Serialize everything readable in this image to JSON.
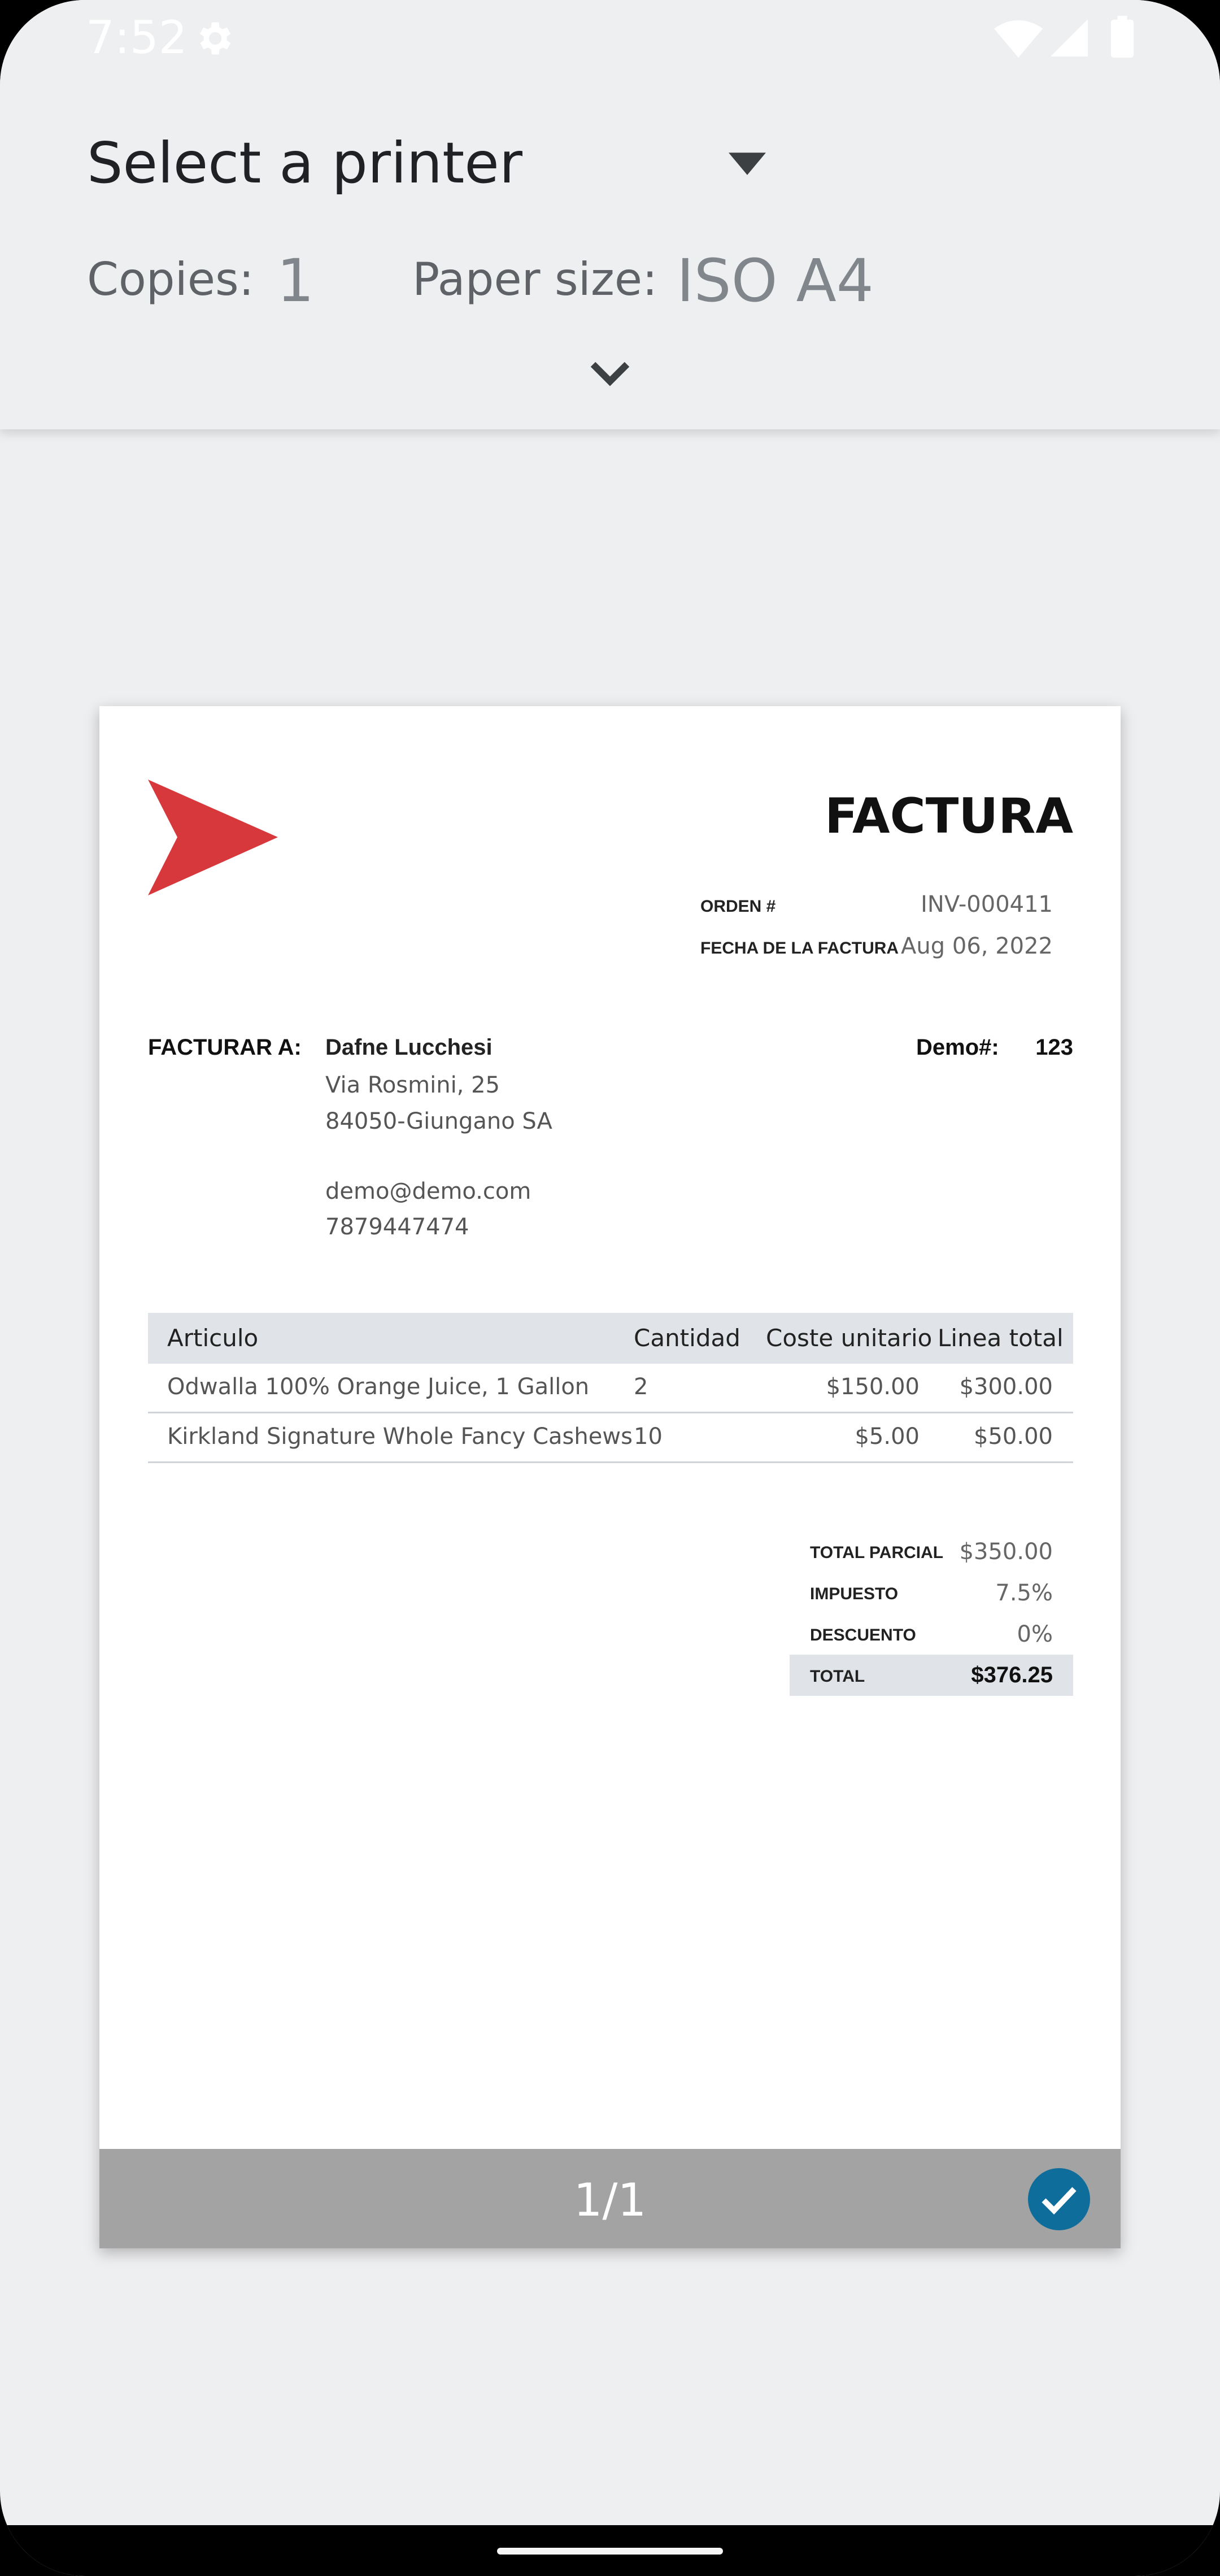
{
  "status_bar": {
    "time": "7:52"
  },
  "print_options": {
    "printer_label": "Select a printer",
    "copies_label": "Copies:",
    "copies_value": "1",
    "paper_label": "Paper size:",
    "paper_value": "ISO A4"
  },
  "invoice": {
    "title": "FACTURA",
    "order_label": "ORDEN #",
    "order_value": "INV-000411",
    "date_label": "FECHA DE LA FACTURA",
    "date_value": "Aug 06, 2022",
    "bill_to_label": "FACTURAR A:",
    "client_name": "Dafne Lucchesi",
    "address_line1": "Via Rosmini, 25",
    "address_line2": "84050-Giungano SA",
    "email": "demo@demo.com",
    "phone": "7879447474",
    "demo_label": "Demo#:",
    "demo_value": "123",
    "columns": {
      "item": "Articulo",
      "qty": "Cantidad",
      "unit": "Coste unitario",
      "line": "Linea total"
    },
    "rows": [
      {
        "item": "Odwalla 100% Orange Juice, 1 Gallon",
        "qty": "2",
        "unit": "$150.00",
        "line": "$300.00"
      },
      {
        "item": "Kirkland Signature Whole Fancy Cashews",
        "qty": "10",
        "unit": "$5.00",
        "line": "$50.00"
      }
    ],
    "totals": {
      "subtotal_label": "TOTAL PARCIAL",
      "subtotal_value": "$350.00",
      "tax_label": "IMPUESTO",
      "tax_value": "7.5%",
      "discount_label": "DESCUENTO",
      "discount_value": "0%",
      "total_label": "TOTAL",
      "total_value": "$376.25"
    }
  },
  "preview": {
    "page_indicator": "1/1"
  },
  "colors": {
    "logo_red": "#d7383c",
    "check_blue": "#0e6d9a",
    "footer_gray": "#a3a3a3"
  }
}
